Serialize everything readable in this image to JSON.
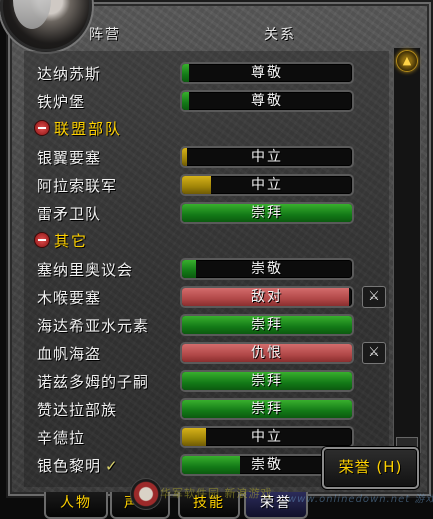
{
  "columns": {
    "faction": "阵营",
    "relation": "关系"
  },
  "rows": [
    {
      "type": "faction",
      "name": "达纳苏斯",
      "standing": "尊敬",
      "color": "#137a17",
      "progress": 0.04,
      "checked": false,
      "war": false
    },
    {
      "type": "faction",
      "name": "铁炉堡",
      "standing": "尊敬",
      "color": "#137a17",
      "progress": 0.04,
      "checked": false,
      "war": false
    },
    {
      "type": "header",
      "name": "联盟部队",
      "collapsed": false
    },
    {
      "type": "faction",
      "name": "银翼要塞",
      "standing": "中立",
      "color": "#a08408",
      "progress": 0.03,
      "checked": false,
      "war": false
    },
    {
      "type": "faction",
      "name": "阿拉索联军",
      "standing": "中立",
      "color": "#a08408",
      "progress": 0.17,
      "checked": false,
      "war": false
    },
    {
      "type": "faction",
      "name": "雷矛卫队",
      "standing": "崇拜",
      "color": "#137a17",
      "progress": 1.0,
      "checked": false,
      "war": false
    },
    {
      "type": "header",
      "name": "其它",
      "collapsed": false
    },
    {
      "type": "faction",
      "name": "塞纳里奥议会",
      "standing": "崇敬",
      "color": "#137a17",
      "progress": 0.08,
      "checked": false,
      "war": false
    },
    {
      "type": "faction",
      "name": "木喉要塞",
      "standing": "敌对",
      "color": "#b14848",
      "progress": 0.98,
      "checked": false,
      "war": true
    },
    {
      "type": "faction",
      "name": "海达希亚水元素",
      "standing": "崇拜",
      "color": "#137a17",
      "progress": 1.0,
      "checked": false,
      "war": false
    },
    {
      "type": "faction",
      "name": "血帆海盗",
      "standing": "仇恨",
      "color": "#b14848",
      "progress": 1.0,
      "checked": false,
      "war": true
    },
    {
      "type": "faction",
      "name": "诺兹多姆的子嗣",
      "standing": "崇拜",
      "color": "#137a17",
      "progress": 1.0,
      "checked": false,
      "war": false
    },
    {
      "type": "faction",
      "name": "赞达拉部族",
      "standing": "崇拜",
      "color": "#137a17",
      "progress": 1.0,
      "checked": false,
      "war": false
    },
    {
      "type": "faction",
      "name": "辛德拉",
      "standing": "中立",
      "color": "#a08408",
      "progress": 0.14,
      "checked": false,
      "war": false
    },
    {
      "type": "faction",
      "name": "银色黎明",
      "standing": "崇敬",
      "color": "#137a17",
      "progress": 0.34,
      "checked": true,
      "war": false
    }
  ],
  "honor_button": "荣誉 (H)",
  "tabs": [
    {
      "label": "人物",
      "active": false
    },
    {
      "label": "声望",
      "active": false
    },
    {
      "label": "技能",
      "active": false
    },
    {
      "label": "荣誉",
      "active": true
    }
  ],
  "watermark": "华军软件园  新浪游戏",
  "watermark2": "www.onlinedown.net  游戏频道  游戏下载"
}
